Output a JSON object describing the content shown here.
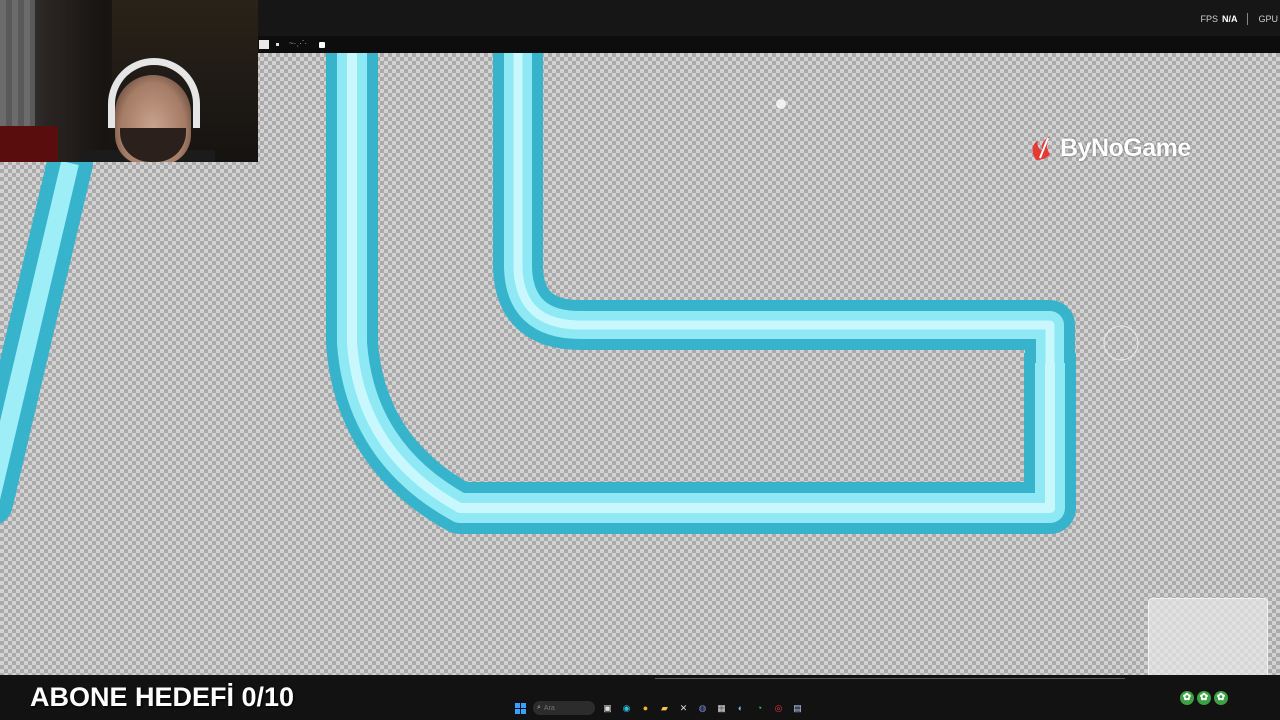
{
  "topbar": {
    "fps_label": "FPS",
    "fps_value": "N/A",
    "gpu_label": "GPU"
  },
  "logo": {
    "text": "ByNoGame"
  },
  "overlay": {
    "goal_text": "ABONE HEDEFİ 0/10"
  },
  "taskbar": {
    "search_placeholder": "Ara"
  },
  "colors": {
    "stroke": "#5ad8ec",
    "checker_light": "#d2d2d2",
    "checker_dark": "#aaaaaa",
    "logo_accent": "#e53935"
  }
}
